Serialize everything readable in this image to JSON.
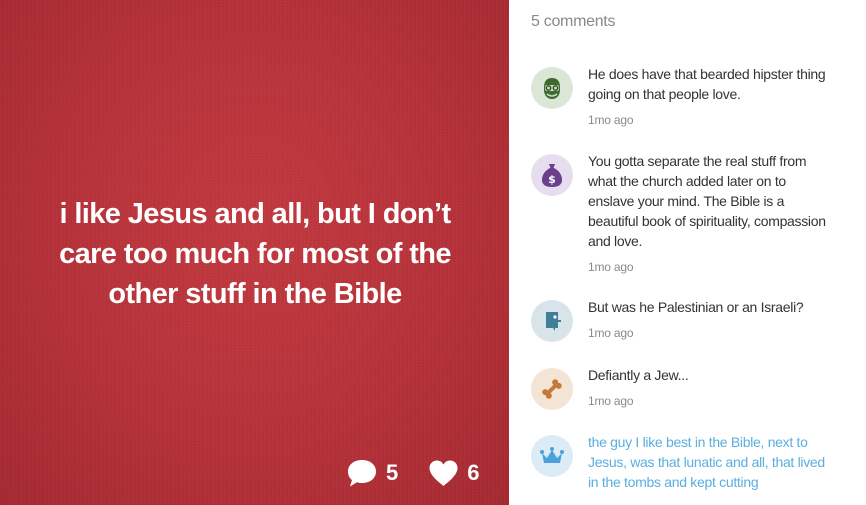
{
  "secret": {
    "text": "i like Jesus and all, but I don’t care too much for most of the other stuff in the Bible",
    "background_color": "#b6323a",
    "replies_count": "5",
    "hearts_count": "6"
  },
  "comments_panel": {
    "count_label": "5 comments",
    "comments": [
      {
        "avatar_icon": "hipster-face-icon",
        "avatar_bg": "#dbe6d6",
        "text": "He does have that bearded hipster thing going on that people love.",
        "time": "1mo ago"
      },
      {
        "avatar_icon": "money-bag-icon",
        "avatar_bg": "#e6ddee",
        "text": "You gotta separate the real stuff from what the church added later on to enslave your mind. The Bible is a beautiful book of spirituality, compassion and love.",
        "time": "1mo ago"
      },
      {
        "avatar_icon": "blue-creature-icon",
        "avatar_bg": "#d8e4ea",
        "text": "But was he Palestinian or an Israeli?",
        "time": "1mo ago"
      },
      {
        "avatar_icon": "bone-icon",
        "avatar_bg": "#f3e4d6",
        "text": "Defiantly a Jew...",
        "time": "1mo ago"
      },
      {
        "avatar_icon": "crown-icon",
        "avatar_bg": "#dcecf7",
        "text": "the guy I like best in the Bible, next to Jesus, was that lunatic and all, that lived in the tombs and kept cutting",
        "time": ""
      }
    ]
  }
}
